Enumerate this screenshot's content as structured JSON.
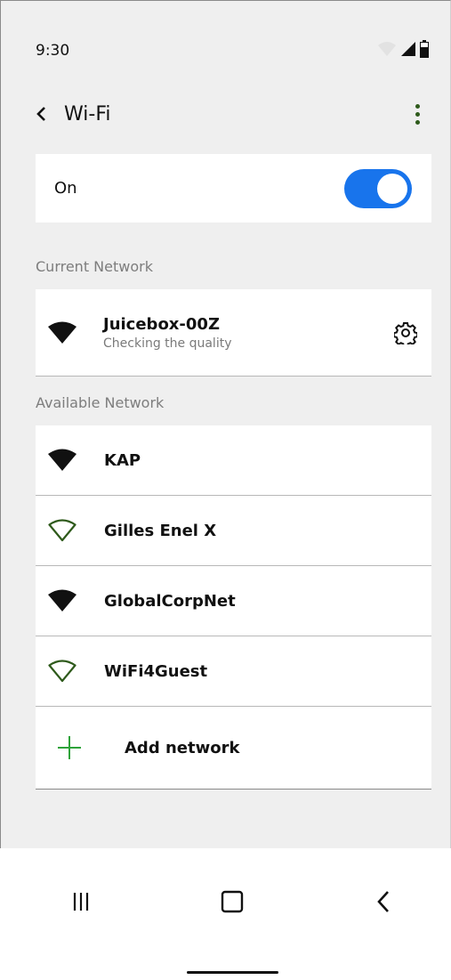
{
  "status_bar": {
    "time": "9:30",
    "icons": [
      "wifi-signal-icon",
      "cellular-signal-icon",
      "battery-icon"
    ]
  },
  "header": {
    "back_icon": "chevron-left-icon",
    "title": "Wi-Fi",
    "menu_icon": "more-vert-icon"
  },
  "wifi_toggle": {
    "label": "On",
    "state": "on",
    "accent_color": "#1874ec"
  },
  "current_network": {
    "section_label": "Current Network",
    "name": "Juicebox-00Z",
    "status": "Checking the quality",
    "icon": "wifi-filled-icon",
    "settings_icon": "gear-icon"
  },
  "available_networks": {
    "section_label": "Available Network",
    "items": [
      {
        "name": "KAP",
        "icon": "wifi-filled-icon"
      },
      {
        "name": "Gilles Enel X",
        "icon": "wifi-outline-icon"
      },
      {
        "name": "GlobalCorpNet",
        "icon": "wifi-filled-icon"
      },
      {
        "name": "WiFi4Guest",
        "icon": "wifi-outline-icon"
      }
    ],
    "add_label": "Add network",
    "add_icon": "plus-icon",
    "outline_icon_color": "#2e5a1b",
    "plus_color": "#2ea33a"
  },
  "navigation": {
    "recents_icon": "recents-icon",
    "home_icon": "home-icon",
    "back_icon": "back-icon"
  }
}
